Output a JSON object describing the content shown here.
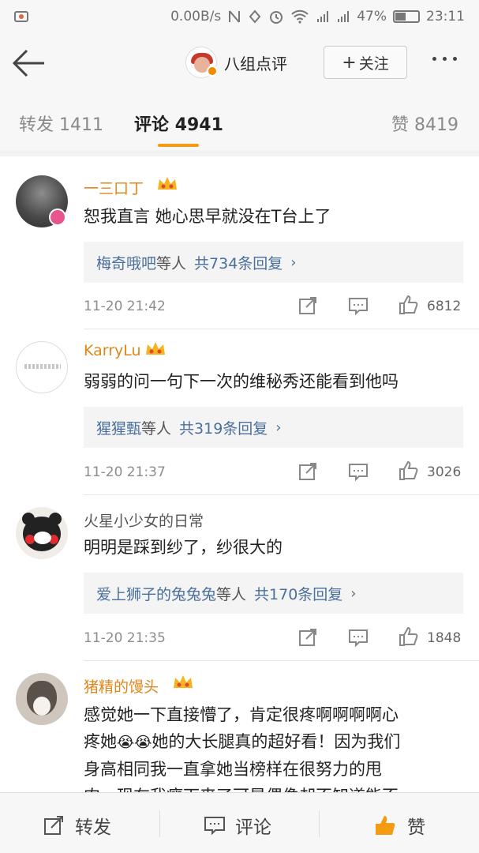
{
  "status": {
    "speed": "0.00B/s",
    "battery": "47%",
    "battery_level": 0.47,
    "time": "23:11"
  },
  "header": {
    "account_name": "八组点评",
    "follow_label": "关注",
    "follow_plus": "+"
  },
  "tabs": [
    {
      "label": "转发",
      "count": "1411"
    },
    {
      "label": "评论",
      "count": "4941"
    },
    {
      "label": "赞",
      "count": "8419"
    }
  ],
  "comments": [
    {
      "user": "一三口丁",
      "text": "恕我直言 她心思早就没在T台上了",
      "reply_users": "梅奇哦吧",
      "reply_etc": "等人",
      "reply_count": "共734条回复",
      "time": "11-20 21:42",
      "likes": "6812"
    },
    {
      "user": "KarryLu",
      "text": "弱弱的问一句下一次的维秘秀还能看到他吗",
      "reply_users": "猩猩甄",
      "reply_etc": "等人",
      "reply_count": "共319条回复",
      "time": "11-20 21:37",
      "likes": "3026"
    },
    {
      "user": "火星小少女的日常",
      "text": "明明是踩到纱了，纱很大的",
      "reply_users": "爱上狮子的兔兔兔",
      "reply_etc": "等人",
      "reply_count": "共170条回复",
      "time": "11-20 21:35",
      "likes": "1848"
    },
    {
      "user": "猪精的馒头",
      "text_line1": "感觉她一下直接懵了，肯定很疼啊啊啊啊心",
      "text_line2_a": "疼她",
      "text_line2_b": "她的大长腿真的超好看！因为我们",
      "text_line3": "身高相同我一直拿她当榜样在很努力的甩",
      "text_line4": "肉，现在我瘦下来了可是偶像却不知道能不"
    }
  ],
  "bottom": {
    "repost": "转发",
    "comment": "评论",
    "like": "赞"
  },
  "colors": {
    "accent_orange": "#f39c12",
    "username_orange": "#e0861a",
    "link_blue": "#4a6f9c"
  }
}
